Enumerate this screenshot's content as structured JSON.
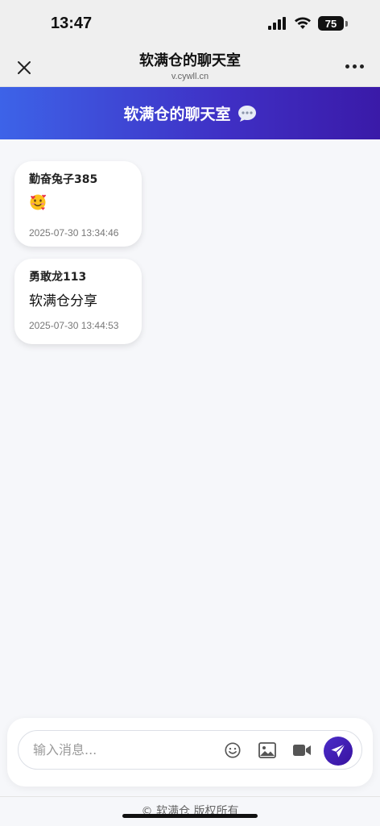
{
  "status_bar": {
    "time": "13:47",
    "battery": "75"
  },
  "nav": {
    "title": "软满仓的聊天室",
    "url": "v.cywll.cn"
  },
  "chat_header": {
    "title": "软满仓的聊天室"
  },
  "messages": [
    {
      "sender": "勤奋兔子385",
      "content_type": "emoji",
      "emoji_name": "smiling-face-with-hearts",
      "timestamp": "2025-07-30 13:34:46"
    },
    {
      "sender": "勇敢龙113",
      "content_type": "text",
      "text": "软满仓分享",
      "timestamp": "2025-07-30 13:44:53"
    }
  ],
  "composer": {
    "placeholder": "输入消息..."
  },
  "footer": {
    "text": "© 软满仓 版权所有"
  },
  "colors": {
    "header_gradient_start": "#3d63e8",
    "header_gradient_end": "#3a1aa8",
    "send_button": "#3e1ab0"
  }
}
